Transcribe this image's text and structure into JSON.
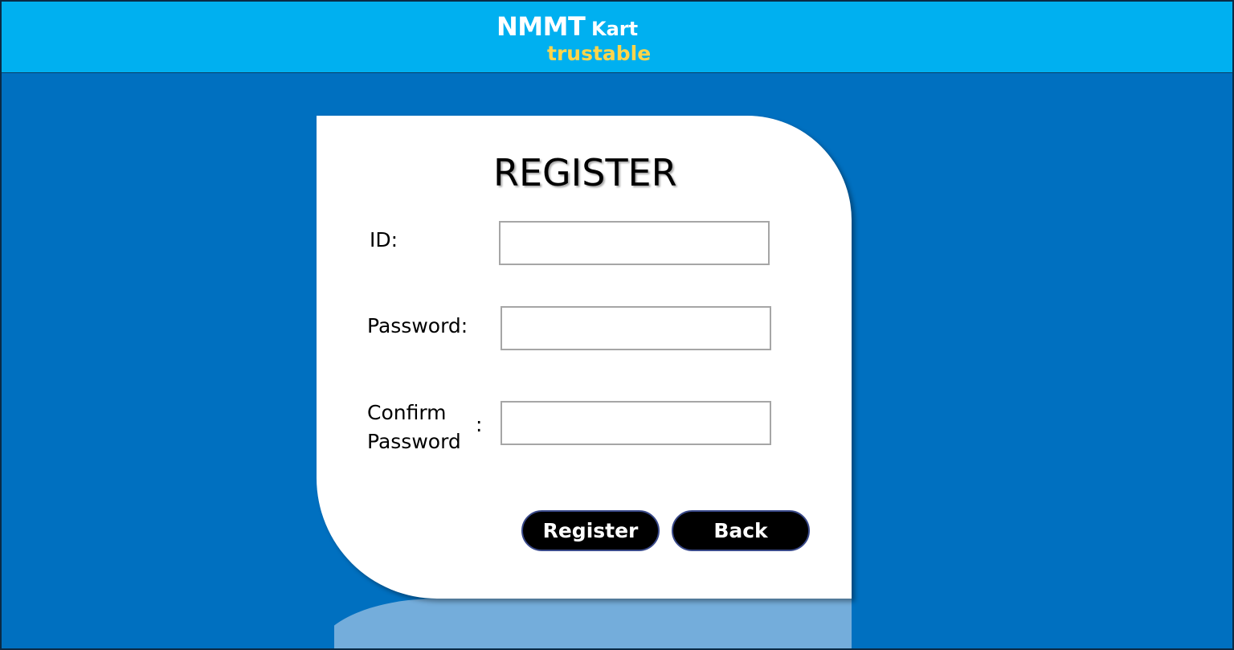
{
  "header": {
    "brand_name": "NMMT",
    "brand_sub": "Kart",
    "tagline": "trustable"
  },
  "form": {
    "title": "REGISTER",
    "id_label": "ID:",
    "password_label": "Password:",
    "confirm_label": "Confirm\nPassword",
    "confirm_colon": ":",
    "id_value": "",
    "password_value": "",
    "confirm_value": "",
    "register_label": "Register",
    "back_label": "Back"
  },
  "colors": {
    "background": "#0070c0",
    "header": "#00b0f0",
    "tagline": "#ffd54a",
    "button": "#000000"
  }
}
